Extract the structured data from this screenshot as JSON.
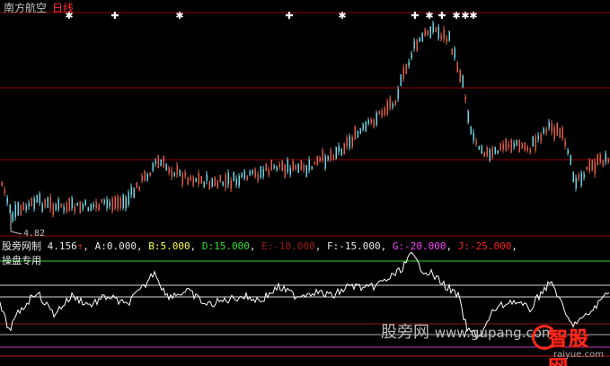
{
  "header": {
    "stock_name": "南方航空",
    "period": "日线"
  },
  "price_panel": {
    "low_price_label": "4.82",
    "colors": {
      "up": "#e0604a",
      "down": "#6fd6e6",
      "grid": "#8b0000",
      "signal": "#ffffff"
    }
  },
  "indicator": {
    "name": "股旁网制",
    "value": "4.156",
    "arrow": "↑",
    "subtitle": "操盘专用",
    "params": [
      {
        "label": "A:",
        "value": "0.000",
        "color": "#e8e8e8"
      },
      {
        "label": "B:",
        "value": "5.000",
        "color": "#ffff40"
      },
      {
        "label": "D:",
        "value": "15.000",
        "color": "#30e030"
      },
      {
        "label": "E:",
        "value": "-10.000",
        "color": "#a01818"
      },
      {
        "label": "F:",
        "value": "-15.000",
        "color": "#e8e8e8"
      },
      {
        "label": "G:",
        "value": "-20.000",
        "color": "#ff40ff"
      },
      {
        "label": "J:",
        "value": "-25.000",
        "color": "#ff2020"
      }
    ]
  },
  "watermark": {
    "text": "股旁网",
    "url": "www.gupang.com",
    "brand": "智股网",
    "brand_url": "raiyue.com"
  }
}
